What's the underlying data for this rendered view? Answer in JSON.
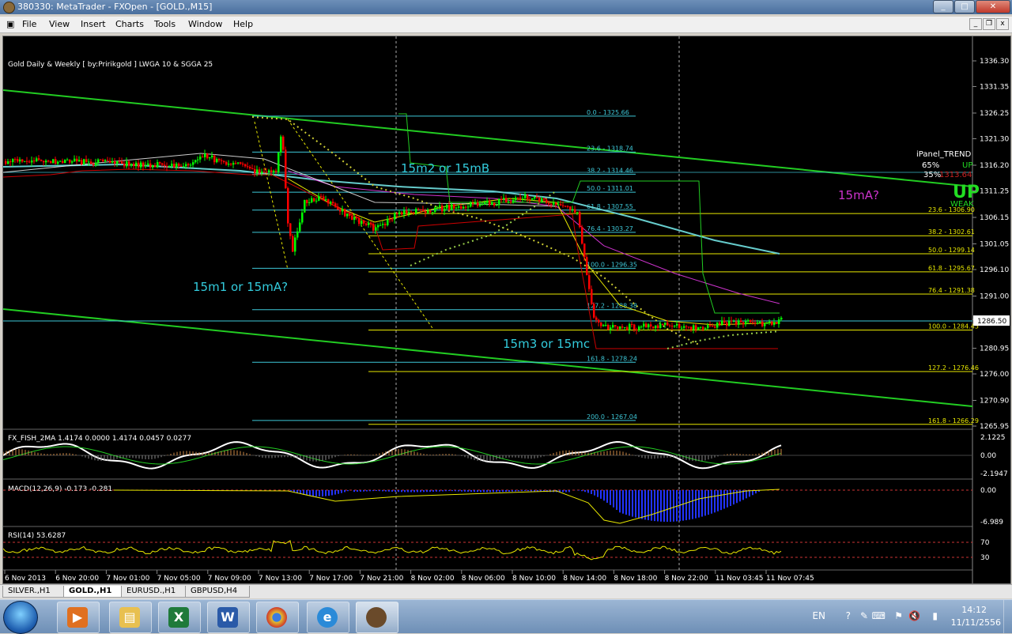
{
  "window": {
    "title": "380330: MetaTrader - FXOpen - [GOLD.,M15]",
    "minimize": "_",
    "maximize": "□",
    "close": "✕"
  },
  "menu": [
    "File",
    "View",
    "Insert",
    "Charts",
    "Tools",
    "Window",
    "Help"
  ],
  "chart": {
    "header": "Gold Daily & Weekly [ by:Pririkgold ] LWGA 10 & SGGA 25",
    "price_axis": [
      "1336.30",
      "1331.35",
      "1326.25",
      "1321.30",
      "1316.20",
      "1311.25",
      "1306.15",
      "1301.05",
      "1296.10",
      "1291.00",
      "1286.50",
      "1280.95",
      "1276.00",
      "1270.90",
      "1265.95"
    ],
    "current_price": "1286.50",
    "time_axis": [
      "6 Nov 2013",
      "6 Nov 20:00",
      "7 Nov 01:00",
      "7 Nov 05:00",
      "7 Nov 09:00",
      "7 Nov 13:00",
      "7 Nov 17:00",
      "7 Nov 21:00",
      "8 Nov 02:00",
      "8 Nov 06:00",
      "8 Nov 10:00",
      "8 Nov 14:00",
      "8 Nov 18:00",
      "8 Nov 22:00",
      "11 Nov 03:45",
      "11 Nov 07:45"
    ],
    "fib_left": [
      "0.0 - 1325.66",
      "23.6 - 1318.74",
      "38.2 - 1314.46",
      "50.0 - 1311.01",
      "61.8 - 1307.55",
      "76.4 - 1303.27",
      "100.0 - 1296.35",
      "127.2 - 1288.38",
      "161.8 - 1278.24",
      "200.0 - 1267.04"
    ],
    "fib_right": [
      "23.6 - 1306.90",
      "38.2 - 1302.61",
      "50.0 - 1299.14",
      "61.8 - 1295.67",
      "76.4 - 1291.38",
      "100.0 - 1284.45",
      "127.2 - 1276.46",
      "161.8 - 1266.29"
    ],
    "annotations": {
      "a1": "15m2 or 15mB",
      "a2": "15m1 or 15mA?",
      "a3": "15m3 or 15mc",
      "a4": "15mA?"
    },
    "ipanel": {
      "title": "iPanel_TREND",
      "p1": "65%",
      "p1_label": "UP",
      "p2": "35%",
      "p2_label": "1313.64",
      "big": "UP",
      "weak": "WEAK"
    }
  },
  "indicators": {
    "fish": {
      "label": "FX_FISH_2MA 1.4174 0.0000 1.4174 0.0457 0.0277",
      "scale": [
        "2.1225",
        "0.00",
        "-2.1947"
      ]
    },
    "macd": {
      "label": "MACD(12,26,9) -0.173 -0.281",
      "scale": [
        "0.00",
        "-6.989"
      ]
    },
    "rsi": {
      "label": "RSI(14) 53.6287",
      "scale": [
        "70",
        "30"
      ]
    }
  },
  "tabs": [
    "SILVER.,H1",
    "GOLD.,H1",
    "EURUSD.,H1",
    "GBPUSD,H4"
  ],
  "active_tab": 1,
  "taskbar": {
    "apps": [
      "media-player",
      "file-explorer",
      "excel",
      "word",
      "chrome",
      "internet-explorer",
      "metatrader"
    ],
    "lang": "EN",
    "time": "14:12",
    "date": "11/11/2556"
  },
  "colors": {
    "chart_bg": "#000000",
    "bull_candle": "#00ff00",
    "bear_candle": "#ff0000",
    "trend_line": "#22cc22",
    "fib_cyan": "#3ec8d8",
    "fib_yellow": "#e8e800",
    "annotation": "#33ccdd",
    "annotation_magenta": "#cc33cc"
  }
}
